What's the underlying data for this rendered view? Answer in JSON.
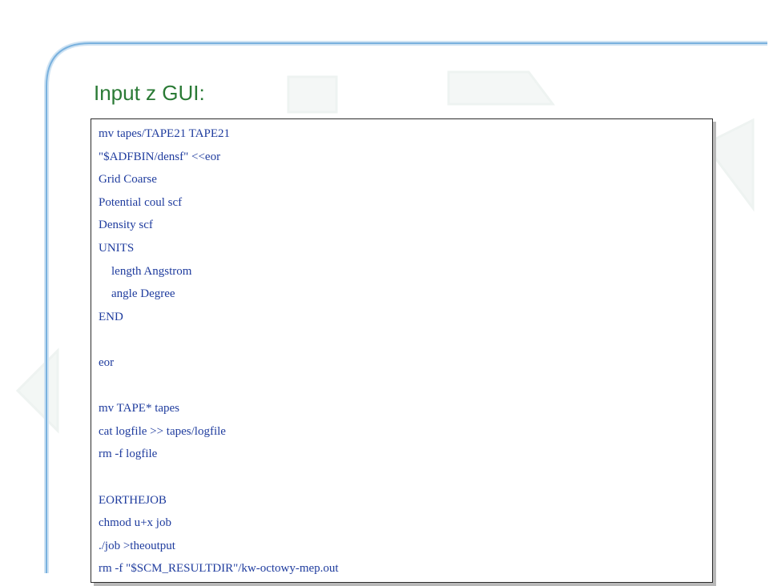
{
  "slide": {
    "title": "Input z GUI:"
  },
  "code_block": {
    "lines": [
      {
        "text": "mv tapes/TAPE21 TAPE21",
        "indent": false
      },
      {
        "text": "\"$ADFBIN/densf\" <<eor",
        "indent": false
      },
      {
        "text": "Grid Coarse",
        "indent": false
      },
      {
        "text": "Potential coul scf",
        "indent": false
      },
      {
        "text": "Density scf",
        "indent": false
      },
      {
        "text": "UNITS",
        "indent": false
      },
      {
        "text": "length Angstrom",
        "indent": true
      },
      {
        "text": "angle Degree",
        "indent": true
      },
      {
        "text": "END",
        "indent": false
      },
      {
        "text": "",
        "indent": false
      },
      {
        "text": "eor",
        "indent": false
      },
      {
        "text": "",
        "indent": false
      },
      {
        "text": "mv TAPE* tapes",
        "indent": false
      },
      {
        "text": "cat logfile >> tapes/logfile",
        "indent": false
      },
      {
        "text": "rm -f logfile",
        "indent": false
      },
      {
        "text": "",
        "indent": false
      },
      {
        "text": "EORTHEJOB",
        "indent": false
      },
      {
        "text": "chmod u+x job",
        "indent": false
      },
      {
        "text": "./job >theoutput",
        "indent": false
      },
      {
        "text": "rm -f \"$SCM_RESULTDIR\"/kw-octowy-mep.out",
        "indent": false
      }
    ]
  },
  "colors": {
    "title": "#2a7a35",
    "code_text": "#1f3c9e",
    "frame": "#6fa8dc"
  }
}
